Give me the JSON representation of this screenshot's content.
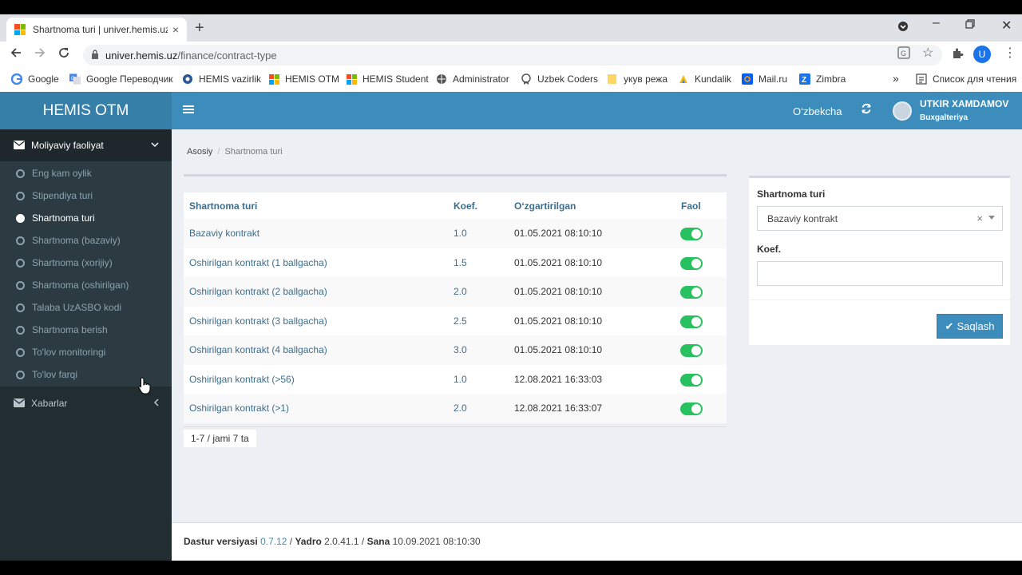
{
  "browser": {
    "tab_title": "Shartnoma turi | univer.hemis.uz",
    "tab_close": "×",
    "new_tab": "+",
    "url_host": "univer.hemis.uz",
    "url_path": "/finance/contract-type",
    "profile_initial": "U",
    "bookmarks": [
      {
        "label": "Google",
        "icon": "google-icon"
      },
      {
        "label": "Google Переводчик",
        "icon": "translate-icon"
      },
      {
        "label": "HEMIS vazirlik",
        "icon": "hemis-icon"
      },
      {
        "label": "HEMIS OTM",
        "icon": "windows-icon"
      },
      {
        "label": "HEMIS Student",
        "icon": "windows-icon"
      },
      {
        "label": "Administrator",
        "icon": "globe-icon"
      },
      {
        "label": "Uzbek Coders",
        "icon": "badge-icon"
      },
      {
        "label": "укув режа",
        "icon": "folder-icon"
      },
      {
        "label": "Kundalik",
        "icon": "kundalik-icon"
      },
      {
        "label": "Mail.ru",
        "icon": "mail-icon"
      },
      {
        "label": "Zimbra",
        "icon": "zimbra-icon"
      }
    ],
    "more": "»",
    "reading_list": "Список для чтения"
  },
  "app": {
    "logo": "HEMIS OTM",
    "language": "O‘zbekcha",
    "user_name": "UTKIR XAMDAMOV",
    "user_role": "Buxgalteriya"
  },
  "sidebar": {
    "section": "Moliyaviy faoliyat",
    "items": [
      {
        "label": "Eng kam oylik",
        "active": false
      },
      {
        "label": "Stipendiya turi",
        "active": false
      },
      {
        "label": "Shartnoma turi",
        "active": true
      },
      {
        "label": "Shartnoma (bazaviy)",
        "active": false
      },
      {
        "label": "Shartnoma (xorijiy)",
        "active": false
      },
      {
        "label": "Shartnoma (oshirilgan)",
        "active": false
      },
      {
        "label": "Talaba UzASBO kodi",
        "active": false
      },
      {
        "label": "Shartnoma berish",
        "active": false
      },
      {
        "label": "To'lov monitoringi",
        "active": false
      },
      {
        "label": "To'lov farqi",
        "active": false
      }
    ],
    "news": "Xabarlar"
  },
  "breadcrumb": {
    "home": "Asosiy",
    "sep": "/",
    "current": "Shartnoma turi"
  },
  "table": {
    "headers": [
      "Shartnoma turi",
      "Koef.",
      "O‘zgartirilgan",
      "Faol"
    ],
    "rows": [
      {
        "name": "Bazaviy kontrakt",
        "koef": "1.0",
        "changed": "01.05.2021 08:10:10",
        "active": true
      },
      {
        "name": "Oshirilgan kontrakt (1 ballgacha)",
        "koef": "1.5",
        "changed": "01.05.2021 08:10:10",
        "active": true
      },
      {
        "name": "Oshirilgan kontrakt (2 ballgacha)",
        "koef": "2.0",
        "changed": "01.05.2021 08:10:10",
        "active": true
      },
      {
        "name": "Oshirilgan kontrakt (3 ballgacha)",
        "koef": "2.5",
        "changed": "01.05.2021 08:10:10",
        "active": true
      },
      {
        "name": "Oshirilgan kontrakt (4 ballgacha)",
        "koef": "3.0",
        "changed": "01.05.2021 08:10:10",
        "active": true
      },
      {
        "name": "Oshirilgan kontrakt (>56)",
        "koef": "1.0",
        "changed": "12.08.2021 16:33:03",
        "active": true
      },
      {
        "name": "Oshirilgan kontrakt (>1)",
        "koef": "2.0",
        "changed": "12.08.2021 16:33:07",
        "active": true
      }
    ],
    "pager": "1-7 / jami 7 ta"
  },
  "form": {
    "type_label": "Shartnoma turi",
    "type_value": "Bazaviy kontrakt",
    "clear": "×",
    "koef_label": "Koef.",
    "koef_value": "",
    "save": "Saqlash"
  },
  "footer": {
    "version_label": "Dastur versiyasi",
    "version": "0.7.12",
    "core_label": "Yadro",
    "core": "2.0.41.1",
    "date_label": "Sana",
    "date": "10.09.2021 08:10:30"
  },
  "colors": {
    "header": "#3c8dbc",
    "logo_bg": "#367fa9",
    "sidebar": "#222d32",
    "toggle_on": "#27c15f"
  }
}
